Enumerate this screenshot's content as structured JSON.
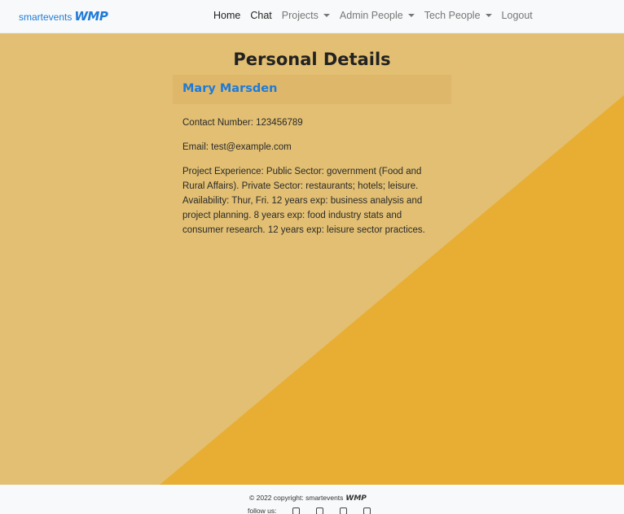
{
  "brand": {
    "text": "smartevents",
    "logo": "WMP"
  },
  "nav": {
    "home": "Home",
    "chat": "Chat",
    "projects": "Projects",
    "admin_people": "Admin People",
    "tech_people": "Tech People",
    "logout": "Logout"
  },
  "page": {
    "title": "Personal Details"
  },
  "person": {
    "name": "Mary Marsden",
    "contact": "Contact Number: 123456789",
    "email": "Email: test@example.com",
    "experience": "Project Experience: Public Sector: government (Food and Rural Affairs). Private Sector: restaurants; hotels; leisure. Availability: Thur, Fri. 12 years exp: business analysis and project planning. 8 years exp: food industry stats and consumer research. 12 years exp: leisure sector practices."
  },
  "footer": {
    "copyright": "© 2022 copyright: smartevents",
    "logo": "WMP",
    "follow": "follow us:",
    "social_icons": [
      "facebook-icon",
      "twitter-icon",
      "instagram-icon",
      "youtube-icon"
    ]
  },
  "colors": {
    "brand": "#1e7bd8",
    "background_light": "#e2bf72",
    "background_dark": "#e8ae33",
    "card_header": "#deb76a"
  }
}
